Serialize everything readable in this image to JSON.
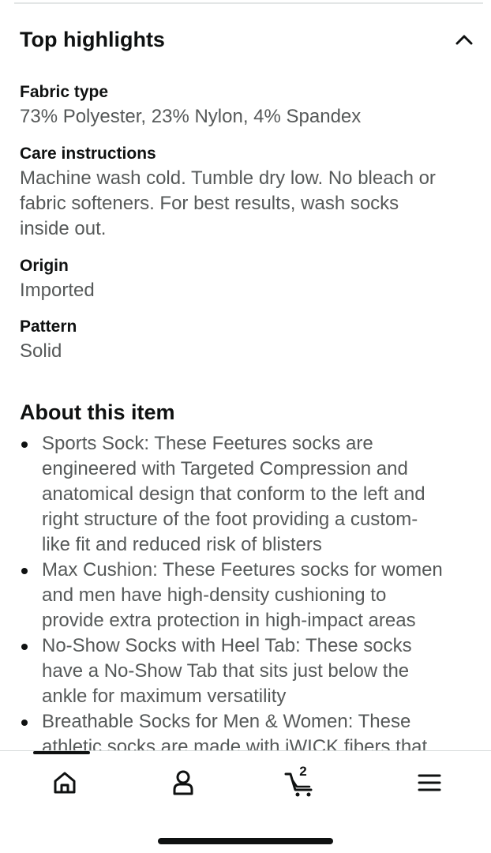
{
  "top_highlights": {
    "title": "Top highlights",
    "attributes": [
      {
        "label": "Fabric type",
        "lines": [
          "73% Polyester, 23% Nylon, 4% Spandex"
        ]
      },
      {
        "label": "Care instructions",
        "lines": [
          "Machine wash cold. Tumble dry low. No bleach or",
          "fabric softeners. For best results, wash socks",
          "inside out."
        ]
      },
      {
        "label": "Origin",
        "lines": [
          "Imported"
        ]
      },
      {
        "label": "Pattern",
        "lines": [
          "Solid"
        ]
      }
    ]
  },
  "about": {
    "title": "About this item",
    "bullets": [
      {
        "lines": [
          "Sports Sock: These Feetures socks are",
          "engineered with Targeted Compression and",
          "anatomical design that conform to the left and",
          "right structure of the foot providing a custom-",
          "like fit and reduced risk of blisters"
        ]
      },
      {
        "lines": [
          "Max Cushion: These Feetures socks for women",
          "and men have high-density cushioning to",
          "provide extra protection in high-impact areas"
        ]
      },
      {
        "lines": [
          "No-Show Socks with Heel Tab: These socks",
          "have a No-Show Tab that sits just below the",
          "ankle for maximum versatility"
        ]
      },
      {
        "lines": [
          "Breathable Socks for Men & Women: These",
          "athletic socks are made with iWICK fibers that"
        ]
      }
    ]
  },
  "nav": {
    "items": [
      {
        "name": "home",
        "icon": "home-icon"
      },
      {
        "name": "account",
        "icon": "person-icon"
      },
      {
        "name": "cart",
        "icon": "cart-icon",
        "count": "2"
      },
      {
        "name": "menu",
        "icon": "hamburger-menu-icon"
      }
    ]
  },
  "colors": {
    "text_primary": "#0f1111",
    "text_secondary": "#565959",
    "divider": "#d5d9d9"
  }
}
